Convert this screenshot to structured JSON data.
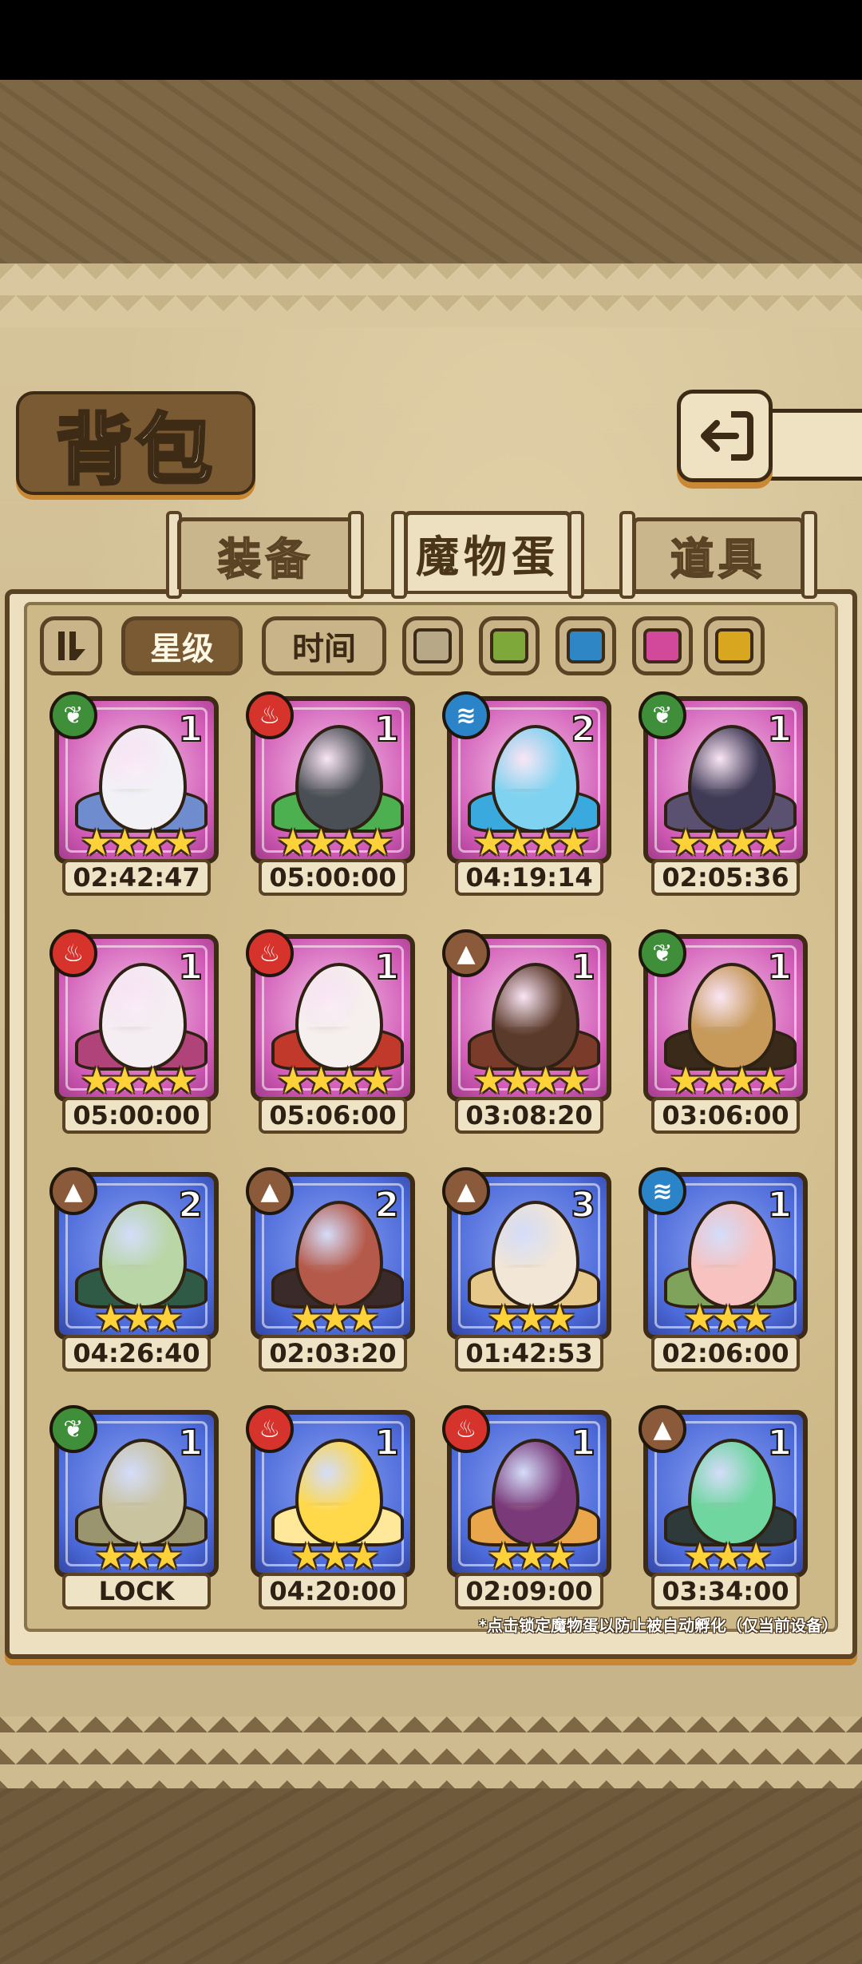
{
  "title": "背包",
  "tabs": [
    {
      "label": "装备",
      "active": false
    },
    {
      "label": "魔物蛋",
      "active": true
    },
    {
      "label": "道具",
      "active": false
    }
  ],
  "filters": {
    "sort_toggle_icon": "sort-toggle-icon",
    "star_label": "星级",
    "time_label": "时间",
    "colors": [
      {
        "name": "gray",
        "hex": "#b7a888"
      },
      {
        "name": "green",
        "hex": "#7ea83a"
      },
      {
        "name": "blue",
        "hex": "#2f86c4"
      },
      {
        "name": "pink",
        "hex": "#d2489b"
      },
      {
        "name": "gold",
        "hex": "#d9a61f"
      }
    ]
  },
  "eggs": [
    {
      "element": "grass",
      "count": "1",
      "stars": "★★★★",
      "timer": "02:42:47",
      "frame": "pink",
      "egg": "#f2f2f6",
      "accent": "#6f8ccf"
    },
    {
      "element": "fire",
      "count": "1",
      "stars": "★★★★",
      "timer": "05:00:00",
      "frame": "pink",
      "egg": "#4a4f55",
      "accent": "#4caf50"
    },
    {
      "element": "water",
      "count": "2",
      "stars": "★★★★",
      "timer": "04:19:14",
      "frame": "pink",
      "egg": "#7fd3f0",
      "accent": "#3aa9dd"
    },
    {
      "element": "grass",
      "count": "1",
      "stars": "★★★★",
      "timer": "02:05:36",
      "frame": "pink",
      "egg": "#3f3a55",
      "accent": "#5a5070"
    },
    {
      "element": "fire",
      "count": "1",
      "stars": "★★★★",
      "timer": "05:00:00",
      "frame": "pink",
      "egg": "#f4eef2",
      "accent": "#b0447a"
    },
    {
      "element": "fire",
      "count": "1",
      "stars": "★★★★",
      "timer": "05:06:00",
      "frame": "pink",
      "egg": "#f5f0ee",
      "accent": "#c0392b"
    },
    {
      "element": "earth",
      "count": "1",
      "stars": "★★★★",
      "timer": "03:08:20",
      "frame": "pink",
      "egg": "#5a3a2a",
      "accent": "#7a3b2a"
    },
    {
      "element": "grass",
      "count": "1",
      "stars": "★★★★",
      "timer": "03:06:00",
      "frame": "pink",
      "egg": "#c79a5a",
      "accent": "#3a2a1a"
    },
    {
      "element": "earth",
      "count": "2",
      "stars": "★★★",
      "timer": "04:26:40",
      "frame": "blue",
      "egg": "#b9d6a6",
      "accent": "#2f5a45"
    },
    {
      "element": "earth",
      "count": "2",
      "stars": "★★★",
      "timer": "02:03:20",
      "frame": "blue",
      "egg": "#b55a4a",
      "accent": "#3a2a2a"
    },
    {
      "element": "earth",
      "count": "3",
      "stars": "★★★",
      "timer": "01:42:53",
      "frame": "blue",
      "egg": "#f2e6d6",
      "accent": "#e6c98a"
    },
    {
      "element": "water",
      "count": "1",
      "stars": "★★★",
      "timer": "02:06:00",
      "frame": "blue",
      "egg": "#f7c2c0",
      "accent": "#7fa35a"
    },
    {
      "element": "grass",
      "count": "1",
      "stars": "★★★",
      "timer": "LOCK",
      "frame": "blue",
      "egg": "#c9c3a0",
      "accent": "#9a956e"
    },
    {
      "element": "fire",
      "count": "1",
      "stars": "★★★",
      "timer": "04:20:00",
      "frame": "blue",
      "egg": "#ffd94a",
      "accent": "#ffe89a"
    },
    {
      "element": "fire",
      "count": "1",
      "stars": "★★★",
      "timer": "02:09:00",
      "frame": "blue",
      "egg": "#7a3a7a",
      "accent": "#e9a64a"
    },
    {
      "element": "earth",
      "count": "1",
      "stars": "★★★",
      "timer": "03:34:00",
      "frame": "blue",
      "egg": "#6fd6a0",
      "accent": "#2e3a3a"
    }
  ],
  "footnote": "*点击锁定魔物蛋以防止被自动孵化（仅当前设备）",
  "colors": {
    "parchment": "#d6c49b",
    "frame_brown": "#5a4224",
    "accent_orange": "#c98934",
    "pink_frame": "#d15bb6",
    "blue_frame": "#4c6ad9",
    "star_gold": "#ffd23a"
  }
}
